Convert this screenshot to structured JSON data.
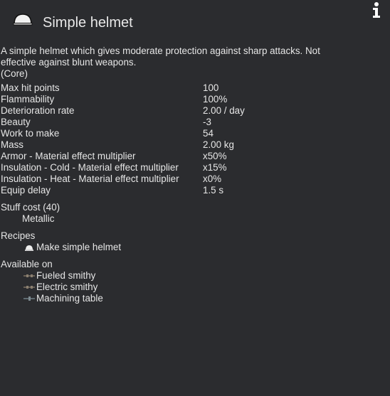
{
  "header": {
    "title": "Simple helmet",
    "thing_icon": "helmet-icon",
    "info_icon": "info-icon"
  },
  "description": "A simple helmet which gives moderate protection against sharp attacks. Not effective against blunt weapons.",
  "source": "(Core)",
  "stats": [
    {
      "label": "Max hit points",
      "value": "100"
    },
    {
      "label": "Flammability",
      "value": "100%"
    },
    {
      "label": "Deterioration rate",
      "value": "2.00 / day"
    },
    {
      "label": "Beauty",
      "value": "-3"
    },
    {
      "label": "Work to make",
      "value": "54"
    },
    {
      "label": "Mass",
      "value": "2.00 kg"
    },
    {
      "label": "Armor - Material effect multiplier",
      "value": "x50%"
    },
    {
      "label": "Insulation - Cold - Material effect multiplier",
      "value": "x15%"
    },
    {
      "label": "Insulation - Heat - Material effect multiplier",
      "value": "x0%"
    },
    {
      "label": "Equip delay",
      "value": "1.5 s"
    }
  ],
  "stuff_cost": {
    "title": "Stuff cost (40)",
    "items": [
      "Metallic"
    ]
  },
  "recipes": {
    "title": "Recipes",
    "items": [
      {
        "label": "Make simple helmet",
        "icon": "helmet-icon"
      }
    ]
  },
  "available_on": {
    "title": "Available on",
    "items": [
      {
        "label": "Fueled smithy",
        "icon": "smithy-icon"
      },
      {
        "label": "Electric smithy",
        "icon": "smithy-icon"
      },
      {
        "label": "Machining table",
        "icon": "machining-table-icon"
      }
    ]
  },
  "colors": {
    "background": "#2b2c2f",
    "text": "#e6e6e6"
  }
}
